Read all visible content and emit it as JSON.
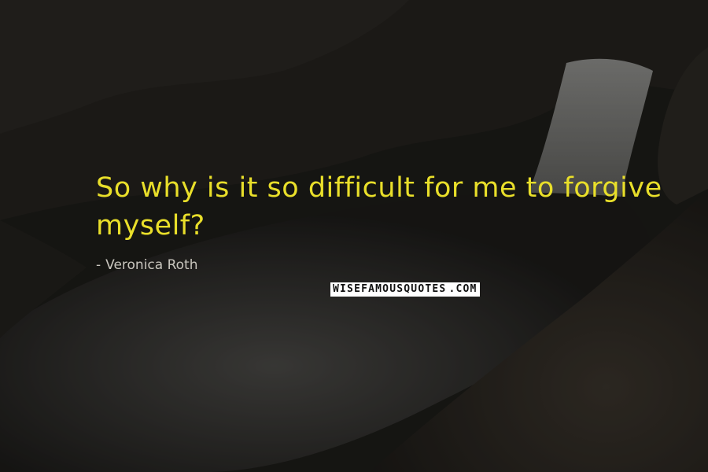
{
  "quote": {
    "text": "So why is it so difficult for me to forgive myself?",
    "color": "#e9df2a"
  },
  "author": {
    "dash": "-",
    "name": "Veronica Roth"
  },
  "watermark": {
    "main": "WISEFAMOUSQUOTES",
    "tld": ".COM"
  }
}
